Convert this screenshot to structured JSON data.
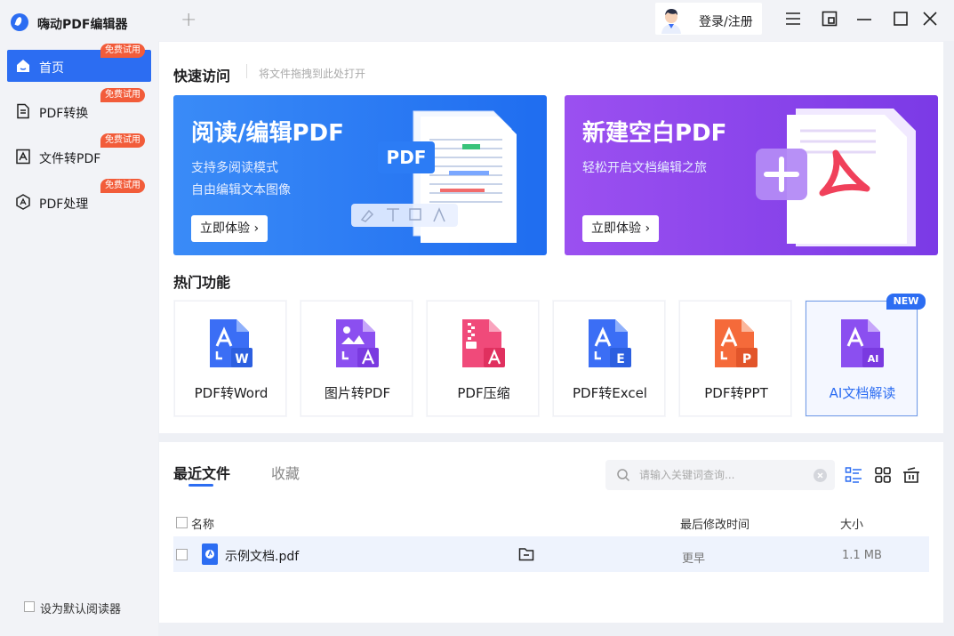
{
  "app": {
    "title": "嗨动PDF编辑器",
    "login_label": "登录/注册"
  },
  "sidebar": {
    "items": [
      {
        "label": "首页",
        "badge": "免费试用",
        "icon": "home-icon"
      },
      {
        "label": "PDF转换",
        "badge": "免费试用",
        "icon": "convert-icon"
      },
      {
        "label": "文件转PDF",
        "badge": "免费试用",
        "icon": "file-to-pdf-icon"
      },
      {
        "label": "PDF处理",
        "badge": "免费试用",
        "icon": "pdf-process-icon"
      }
    ],
    "default_reader_label": "设为默认阅读器"
  },
  "quick_access": {
    "title": "快速访问",
    "hint": "将文件拖拽到此处打开",
    "banners": [
      {
        "title": "阅读/编辑PDF",
        "line1": "支持多阅读模式",
        "line2": "自由编辑文本图像",
        "button": "立即体验 ›",
        "color": "#2c6df2"
      },
      {
        "title": "新建空白PDF",
        "line1": "轻松开启文档编辑之旅",
        "line2": "",
        "button": "立即体验 ›",
        "color": "#8a45ec"
      }
    ]
  },
  "hot_features": {
    "title": "热门功能",
    "new_badge": "NEW",
    "items": [
      {
        "label": "PDF转Word",
        "icon": "pdf-to-word-icon",
        "color": "#3b6ef5"
      },
      {
        "label": "图片转PDF",
        "icon": "image-to-pdf-icon",
        "color": "#8b4ff0"
      },
      {
        "label": "PDF压缩",
        "icon": "pdf-compress-icon",
        "color": "#f04a7a"
      },
      {
        "label": "PDF转Excel",
        "icon": "pdf-to-excel-icon",
        "color": "#3b6ef5"
      },
      {
        "label": "PDF转PPT",
        "icon": "pdf-to-ppt-icon",
        "color": "#f56a3a"
      },
      {
        "label": "AI文档解读",
        "icon": "ai-doc-icon",
        "color": "#8b4ff0"
      }
    ]
  },
  "recent": {
    "tabs": [
      "最近文件",
      "收藏"
    ],
    "search_placeholder": "请输入关键词查询...",
    "columns": {
      "name": "名称",
      "modified": "最后修改时间",
      "size": "大小"
    },
    "files": [
      {
        "name": "示例文档.pdf",
        "modified": "更早",
        "size": "1.1 MB"
      }
    ]
  }
}
